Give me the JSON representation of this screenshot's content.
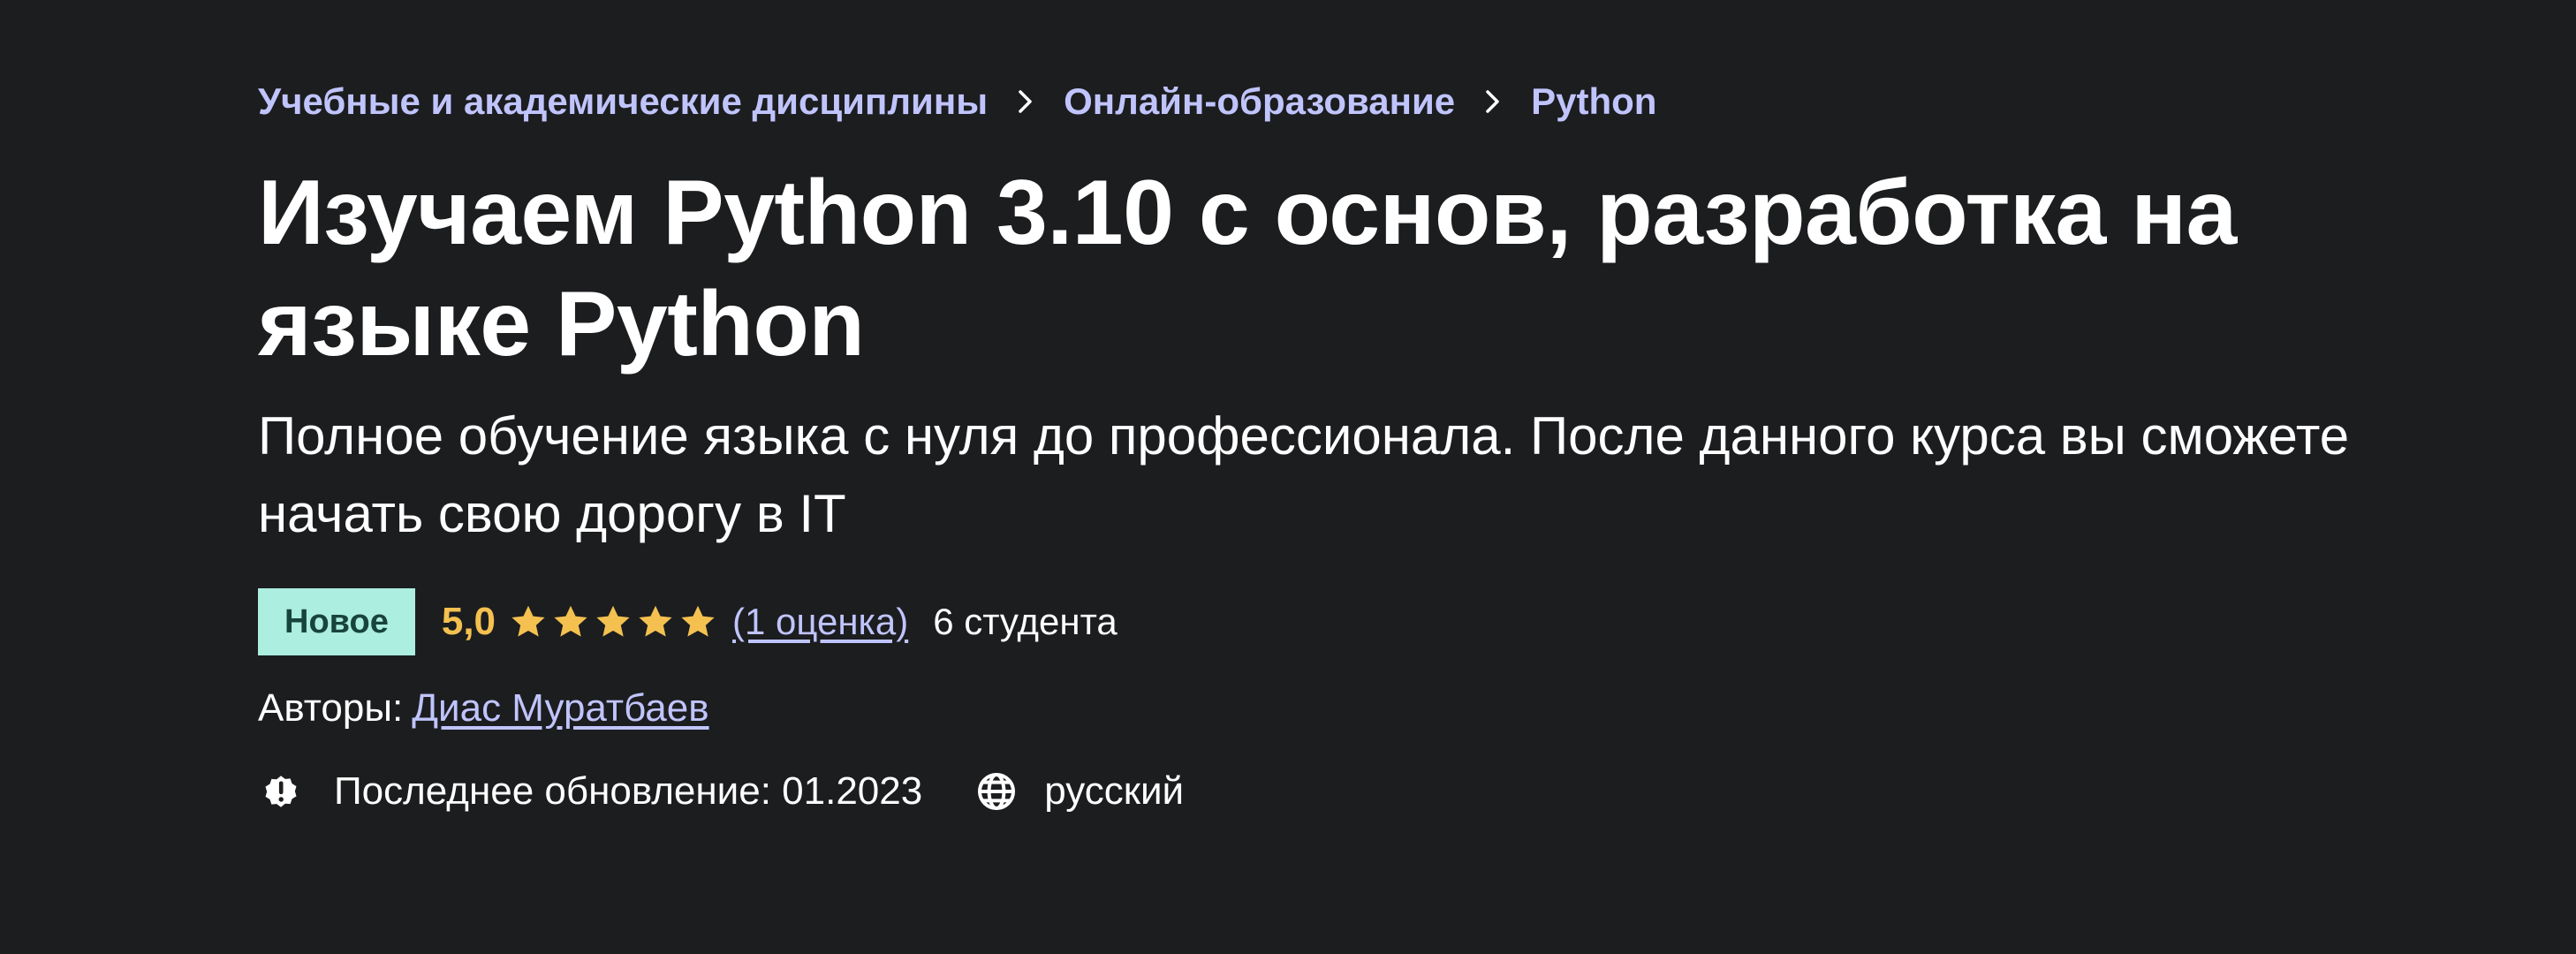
{
  "breadcrumb": {
    "items": [
      {
        "label": "Учебные и академические дисциплины"
      },
      {
        "label": "Онлайн-образование"
      },
      {
        "label": "Python"
      }
    ],
    "separator_icon": "chevron-right-icon"
  },
  "course": {
    "title": "Изучаем Python 3.10 с основ, разработка на языке Python",
    "subtitle": "Полное обучение языка с нуля до профессионала. После данного курса вы сможете начать свою дорогу в IT"
  },
  "rating": {
    "badge": "Новое",
    "value": "5,0",
    "stars_filled": 5,
    "stars_total": 5,
    "count_label": "(1 оценка)",
    "students": "6 студента"
  },
  "authors": {
    "label": "Авторы:",
    "name": "Диас Муратбаев"
  },
  "meta": {
    "last_updated": "Последнее обновление: 01.2023",
    "language": "русский",
    "update_icon": "alert-badge-icon",
    "language_icon": "globe-icon"
  },
  "colors": {
    "background": "#1c1d1f",
    "link": "#c0c4fc",
    "star": "#f4c150",
    "badge_bg": "#aceee0",
    "badge_text": "#18443b",
    "text": "#ffffff"
  }
}
